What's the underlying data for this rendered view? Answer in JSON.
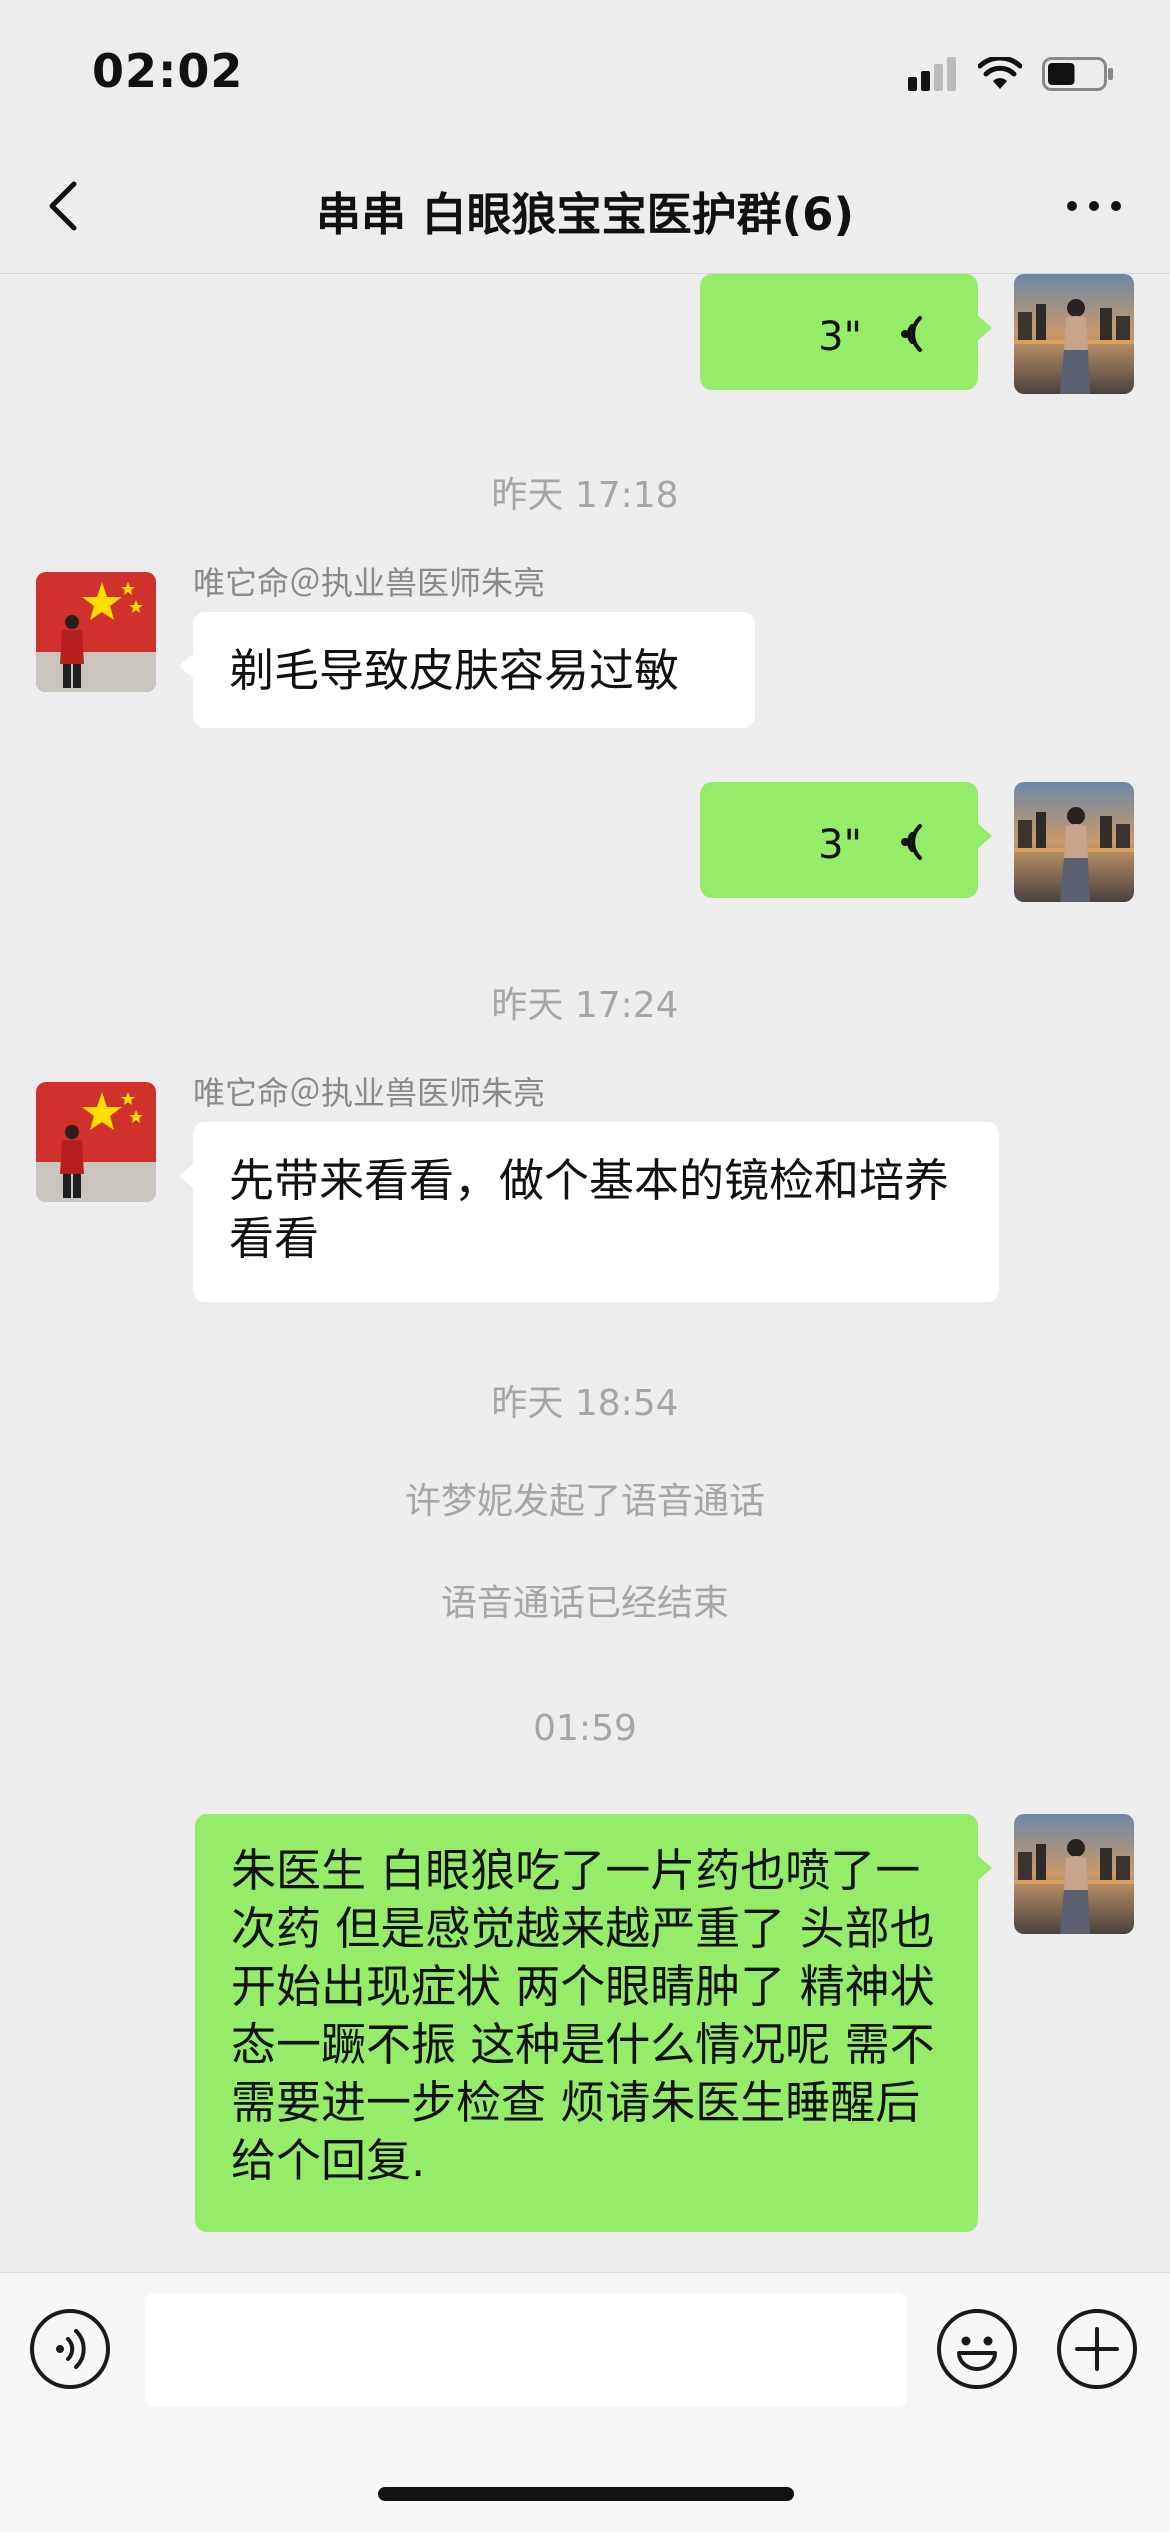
{
  "status_bar": {
    "time": "02:02",
    "battery_percent": 50
  },
  "nav": {
    "title": "串串 白眼狼宝宝医护群(6)",
    "back_icon": "chevron-left-icon",
    "more_icon": "ellipsis-icon"
  },
  "messages": [
    {
      "type": "voice",
      "direction": "out",
      "duration": "3\""
    },
    {
      "type": "time",
      "text": "昨天 17:18"
    },
    {
      "type": "text",
      "direction": "in",
      "sender": "唯它命＠执业兽医师朱亮",
      "text": "剃毛导致皮肤容易过敏"
    },
    {
      "type": "voice",
      "direction": "out",
      "duration": "3\""
    },
    {
      "type": "time",
      "text": "昨天 17:24"
    },
    {
      "type": "text",
      "direction": "in",
      "sender": "唯它命＠执业兽医师朱亮",
      "text": "先带来看看，做个基本的镜检和培养看看"
    },
    {
      "type": "time",
      "text": "昨天 18:54"
    },
    {
      "type": "system",
      "text": "许梦妮发起了语音通话"
    },
    {
      "type": "system",
      "text": "语音通话已经结束"
    },
    {
      "type": "time",
      "text": "01:59"
    },
    {
      "type": "text",
      "direction": "out",
      "text": "朱医生 白眼狼吃了一片药也喷了一次药 但是感觉越来越严重了 头部也开始出现症状 两个眼睛肿了 精神状态一蹶不振 这种是什么情况呢 需不需要进一步检查 烦请朱医生睡醒后给个回复."
    }
  ],
  "input_bar": {
    "voice_icon": "voice-mode-icon",
    "emoji_icon": "emoji-icon",
    "plus_icon": "plus-icon",
    "input_value": ""
  },
  "colors": {
    "background": "#ededed",
    "outgoing_bubble": "#95ec69",
    "incoming_bubble": "#ffffff",
    "meta_text": "#a6a6a6"
  }
}
